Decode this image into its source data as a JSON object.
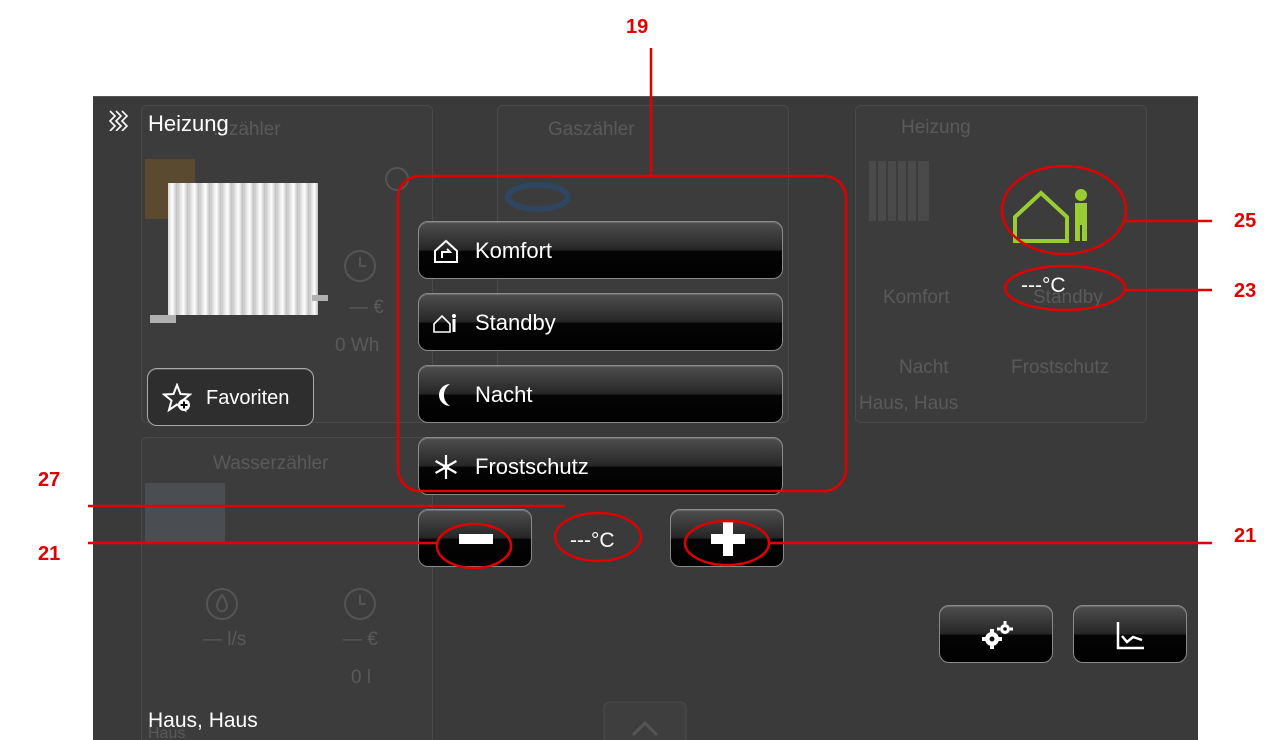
{
  "header": {
    "title": "Heizung"
  },
  "background_cards": {
    "strom": "...zähler",
    "gas": "Gaszähler",
    "heizung": "Heizung",
    "wasser": "Wasserzähler",
    "cost_left": "— €",
    "energy_left": "0 Wh",
    "flow": "— l/s",
    "cost_water": "— €",
    "volume": "0 l",
    "haus_right": "Haus, Haus",
    "ghost_komfort": "Komfort",
    "ghost_standby": "Standby",
    "ghost_nacht": "Nacht",
    "ghost_frost": "Frostschutz",
    "haus_left": "Haus"
  },
  "modes": [
    {
      "label": "Komfort",
      "icon": "house-hand-icon"
    },
    {
      "label": "Standby",
      "icon": "house-person-icon"
    },
    {
      "label": "Nacht",
      "icon": "moon-icon"
    },
    {
      "label": "Frostschutz",
      "icon": "snowflake-icon"
    }
  ],
  "favorites": {
    "label": "Favoriten",
    "icon": "star-plus-icon"
  },
  "setpoint": {
    "value": "---°C"
  },
  "status": {
    "temperature": "---°C",
    "mode_icon": "house-person-icon",
    "mode_color": "#9acd32"
  },
  "location": {
    "label": "Haus, Haus"
  },
  "toolbar": {
    "settings_icon": "gears-icon",
    "chart_icon": "chart-icon"
  },
  "callouts": {
    "c19": "19",
    "c25": "25",
    "c23": "23",
    "c27": "27",
    "c21_left": "21",
    "c21_right": "21"
  },
  "colors": {
    "callout": "#e00000",
    "accent": "#9acd32",
    "background": "#3a3a3a"
  }
}
